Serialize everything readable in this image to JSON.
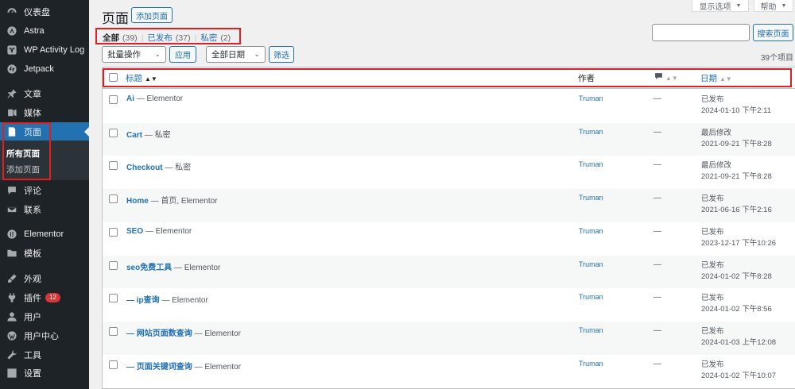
{
  "sidebar": {
    "items": [
      {
        "label": "仪表盘",
        "icon": "dashboard-icon"
      },
      {
        "label": "Astra",
        "icon": "astra-icon"
      },
      {
        "label": "WP Activity Log",
        "icon": "activity-log-icon"
      },
      {
        "label": "Jetpack",
        "icon": "jetpack-icon"
      },
      {
        "label": "文章",
        "icon": "pin-icon"
      },
      {
        "label": "媒体",
        "icon": "media-icon"
      },
      {
        "label": "页面",
        "icon": "page-icon"
      },
      {
        "label": "评论",
        "icon": "comment-icon"
      },
      {
        "label": "联系",
        "icon": "mail-icon"
      },
      {
        "label": "Elementor",
        "icon": "elementor-icon"
      },
      {
        "label": "模板",
        "icon": "folder-icon"
      },
      {
        "label": "外观",
        "icon": "brush-icon"
      },
      {
        "label": "插件",
        "icon": "plugin-icon",
        "badge": "12"
      },
      {
        "label": "用户",
        "icon": "user-icon"
      },
      {
        "label": "用户中心",
        "icon": "wordpress-icon"
      },
      {
        "label": "工具",
        "icon": "wrench-icon"
      },
      {
        "label": "设置",
        "icon": "settings-icon"
      }
    ],
    "submenu": [
      "所有页面",
      "添加页面"
    ]
  },
  "header": {
    "title": "页面",
    "add_new": "添加页面",
    "screen_options": "显示选项",
    "help": "帮助"
  },
  "views": {
    "all": "全部",
    "all_count": "(39)",
    "publish": "已发布",
    "publish_count": "(37)",
    "private": "私密",
    "private_count": "(2)"
  },
  "search": {
    "button": "搜索页面",
    "value": ""
  },
  "bulk": {
    "select": "批量操作",
    "apply": "应用",
    "dates": "全部日期",
    "filter": "筛选",
    "items_count": "39个项目"
  },
  "table": {
    "headers": {
      "title": "标题",
      "author": "作者",
      "date": "日期"
    },
    "rows": [
      {
        "title": "Ai",
        "suffix": " — Elementor",
        "author": "Truman",
        "comments": "—",
        "status": "已发布",
        "date": "2024-01-10 下午2:11"
      },
      {
        "title": "Cart",
        "suffix": " — 私密",
        "author": "Truman",
        "comments": "—",
        "status": "最后修改",
        "date": "2021-09-21 下午8:28"
      },
      {
        "title": "Checkout",
        "suffix": " — 私密",
        "author": "Truman",
        "comments": "—",
        "status": "最后修改",
        "date": "2021-09-21 下午8:28"
      },
      {
        "title": "Home",
        "suffix": " — 首页, Elementor",
        "author": "Truman",
        "comments": "—",
        "status": "已发布",
        "date": "2021-06-16 下午2:16"
      },
      {
        "title": "SEO",
        "suffix": " — Elementor",
        "author": "Truman",
        "comments": "—",
        "status": "已发布",
        "date": "2023-12-17 下午10:26"
      },
      {
        "title": "seo免费工具",
        "suffix": " — Elementor",
        "author": "Truman",
        "comments": "—",
        "status": "已发布",
        "date": "2024-01-02 下午8:28"
      },
      {
        "title": "— ip查询",
        "suffix": " — Elementor",
        "author": "Truman",
        "comments": "—",
        "status": "已发布",
        "date": "2024-01-02 下午8:56"
      },
      {
        "title": "— 网站页面数查询",
        "suffix": " — Elementor",
        "author": "Truman",
        "comments": "—",
        "status": "已发布",
        "date": "2024-01-03 上午12:08"
      },
      {
        "title": "— 页面关键词查询",
        "suffix": " — Elementor",
        "author": "Truman",
        "comments": "—",
        "status": "已发布",
        "date": "2024-01-02 下午10:07"
      }
    ]
  },
  "colors": {
    "accent": "#2271b1",
    "sidebar": "#1d2327",
    "highlight": "#e02020",
    "badge": "#d63638"
  }
}
